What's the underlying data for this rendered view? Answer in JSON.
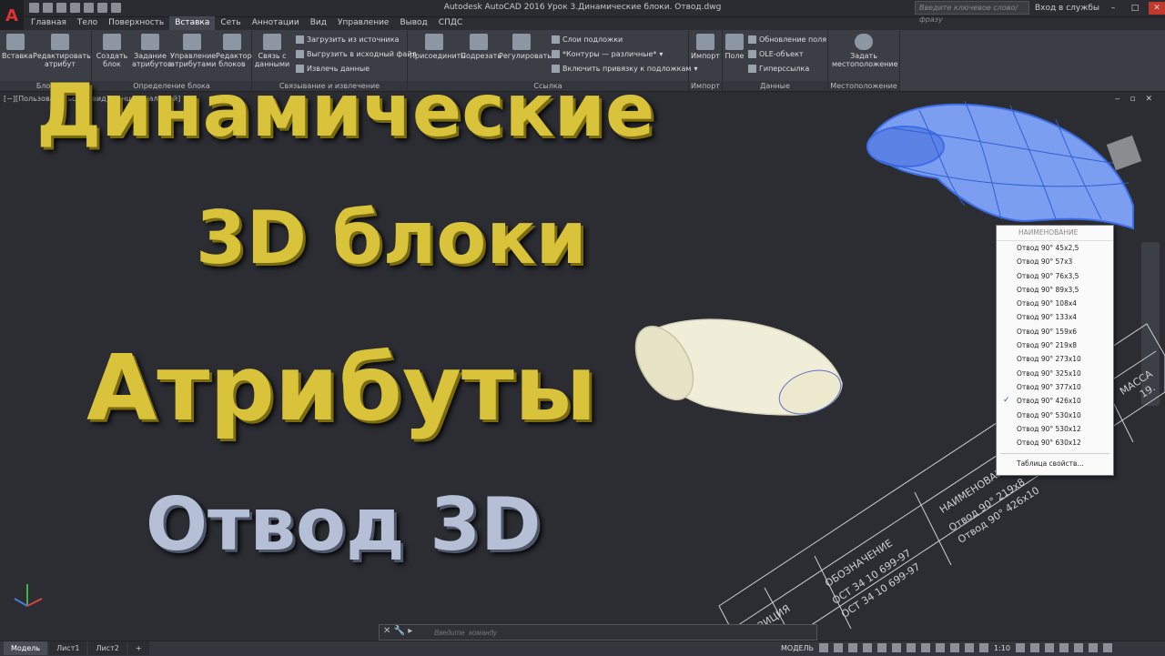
{
  "titlebar": {
    "title": "Autodesk AutoCAD 2016   Урок 3.Динамические блоки. Отвод.dwg",
    "search_placeholder": "Введите ключевое слово/фразу",
    "login": "Вход в службы"
  },
  "tabs": [
    "Главная",
    "Тело",
    "Поверхность",
    "Вставка",
    "Сеть",
    "Аннотации",
    "Вид",
    "Управление",
    "Вывод",
    "СПДС"
  ],
  "active_tab": "Вставка",
  "ribbon": {
    "block_panel": {
      "title": "Блок",
      "buttons": [
        "Вставка",
        "Редактировать атрибут"
      ]
    },
    "block_def_panel": {
      "title": "Определение блока",
      "buttons": [
        "Создать блок",
        "Задание атрибутов",
        "Управление атрибутами",
        "Редактор блоков"
      ]
    },
    "link_panel": {
      "title": "Связывание и извлечение",
      "button": "Связь с данными",
      "rows": [
        "Загрузить из источника",
        "Выгрузить в исходный файл",
        "Извлечь  данные"
      ]
    },
    "ref_panel": {
      "title": "Ссылка",
      "buttons": [
        "Присоединить",
        "Подрезать",
        "Регулировать"
      ],
      "rows": [
        "Слои подложки",
        "*Контуры — различные*",
        "Включить привязку к подложкам"
      ]
    },
    "import_panel": {
      "title": "Импорт",
      "button": "Импорт"
    },
    "data_panel": {
      "title": "Данные",
      "button": "Поле",
      "rows": [
        "Обновление  поля",
        "OLE-объект",
        "Гиперссылка"
      ]
    },
    "location_panel": {
      "title": "Местоположение",
      "button": "Задать местоположение"
    }
  },
  "viewport": {
    "label": "[−][Пользовательский вид][Концептуальный]"
  },
  "overlay": {
    "line1": "Динамические",
    "line2": "3D блоки",
    "line3": "Атрибуты",
    "line4": "Отвод 3D"
  },
  "dropdown": {
    "header": "НАИМЕНОВАНИЕ",
    "items": [
      "Отвод 90° 45х2,5",
      "Отвод 90° 57х3",
      "Отвод 90° 76х3,5",
      "Отвод 90° 89х3,5",
      "Отвод 90° 108х4",
      "Отвод 90° 133х4",
      "Отвод 90° 159х6",
      "Отвод 90° 219х8",
      "Отвод 90° 273х10",
      "Отвод 90° 325х10",
      "Отвод 90° 377х10",
      "Отвод 90° 426х10",
      "Отвод 90° 530х10",
      "Отвод 90° 530х12",
      "Отвод 90° 630х12"
    ],
    "selected_index": 11,
    "footer": "Таблица свойств..."
  },
  "table": {
    "col_position": "ПОЗИЦИЯ",
    "col_designation": "ОБОЗНАЧЕНИЕ",
    "col_name": "НАИМЕНОВАНИЕ",
    "col_mass": "МАССА",
    "designation_1": "ОСТ 34 10 699-97",
    "designation_2": "ОСТ 34 10 699-97",
    "name_1": "Отвод 90° 219х8",
    "name_2": "Отвод 90° 426х10",
    "mass_1": "19."
  },
  "command": {
    "placeholder": "Введите  команду"
  },
  "statusbar": {
    "layout_tabs": [
      "Модель",
      "Лист1",
      "Лист2"
    ],
    "active_layout": "Модель",
    "mode": "МОДЕЛЬ",
    "scale": "1:10"
  },
  "colors": {
    "viewport_bg": "#2b2d33",
    "title_gold": "#d8c33a",
    "title_silver": "#b5bfd6",
    "pipe_blue": "#7b9ef0",
    "pipe_cream": "#f0eed8"
  }
}
